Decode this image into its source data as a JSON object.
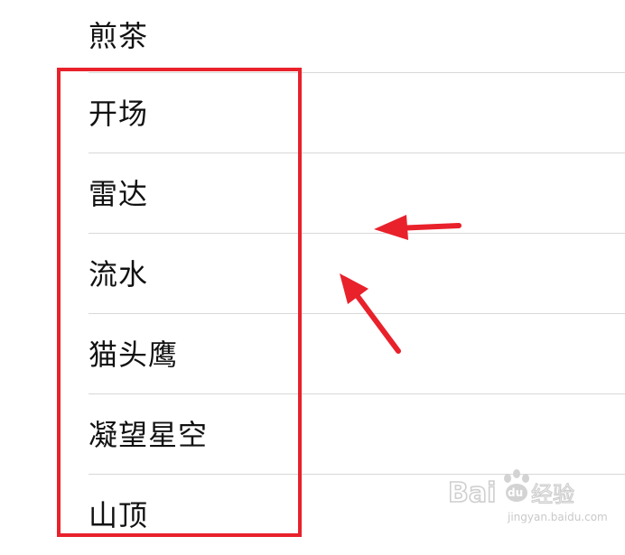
{
  "list": {
    "items": [
      {
        "label": "煎茶"
      },
      {
        "label": "开场"
      },
      {
        "label": "雷达"
      },
      {
        "label": "流水"
      },
      {
        "label": "猫头鹰"
      },
      {
        "label": "凝望星空"
      },
      {
        "label": "山顶"
      }
    ]
  },
  "highlight": {
    "color": "#e8212b"
  },
  "watermark": {
    "brand": "Baidu经验",
    "url": "jingyan.baidu.com"
  },
  "colors": {
    "text": "#111111",
    "divider": "#d8d8d8",
    "annotation": "#e8212b",
    "watermark": "#c9c9c9"
  }
}
